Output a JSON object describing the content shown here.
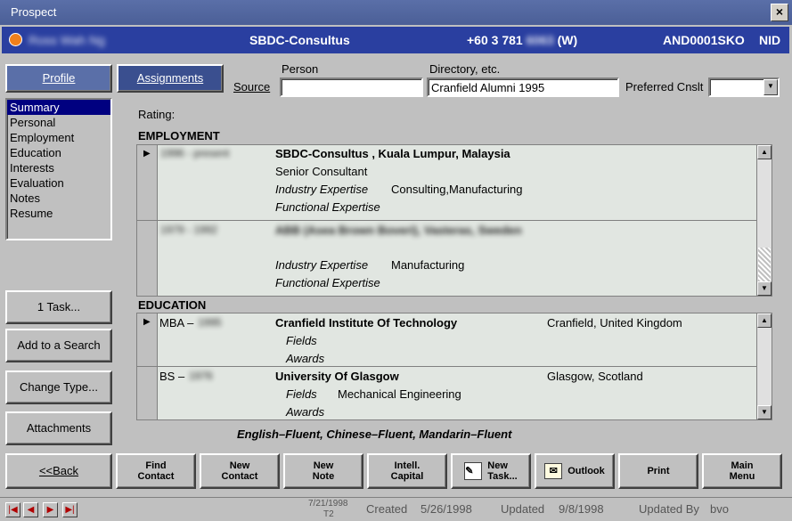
{
  "window": {
    "title": "Prospect",
    "close": "×"
  },
  "infobar": {
    "name": "Ross Wah Ng",
    "company": "SBDC-Consultus",
    "phone_prefix": "+60 3 781",
    "phone_hidden": "6063",
    "phone_suffix": "(W)",
    "code": "AND0001SKO",
    "flag": "NID"
  },
  "tabs": {
    "profile": "Profile",
    "assignments": "Assignments"
  },
  "source": {
    "label": "Source",
    "person_label": "Person",
    "person_value": "",
    "directory_label": "Directory, etc.",
    "directory_value": "Cranfield Alumni 1995",
    "preferred_label": "Preferred Cnslt",
    "preferred_value": ""
  },
  "sections": [
    "Summary",
    "Personal",
    "Employment",
    "Education",
    "Interests",
    "Evaluation",
    "Notes",
    "Resume"
  ],
  "side_buttons": {
    "task": "1 Task...",
    "add_search": "Add to a Search",
    "change_type": "Change Type...",
    "attachments": "Attachments",
    "back": "<<Back"
  },
  "rating_label": "Rating:",
  "employment": {
    "heading": "EMPLOYMENT",
    "entries": [
      {
        "dates": "1996 - present",
        "company": "SBDC-Consultus , Kuala Lumpur, Malaysia",
        "title": "Senior Consultant",
        "industry_label": "Industry Expertise",
        "industry": "Consulting,Manufacturing",
        "functional_label": "Functional Expertise",
        "functional": ""
      },
      {
        "dates": "1979 - 1992",
        "company": "ABB (Asea Brown Boveri), Vasteras, Sweden",
        "title": "",
        "industry_label": "Industry Expertise",
        "industry": "Manufacturing",
        "functional_label": "Functional Expertise",
        "functional": ""
      }
    ]
  },
  "education": {
    "heading": "EDUCATION",
    "entries": [
      {
        "degree": "MBA –",
        "year": "1995",
        "school": "Cranfield Institute Of Technology",
        "location": "Cranfield, United Kingdom",
        "fields_label": "Fields",
        "fields": "",
        "awards_label": "Awards"
      },
      {
        "degree": "BS –",
        "year": "1976",
        "school": "University Of Glasgow",
        "location": "Glasgow, Scotland",
        "fields_label": "Fields",
        "fields": "Mechanical Engineering",
        "awards_label": "Awards"
      }
    ]
  },
  "languages": "English–Fluent, Chinese–Fluent, Mandarin–Fluent",
  "toolbar": {
    "find1": "Find",
    "find2": "Contact",
    "newc1": "New",
    "newc2": "Contact",
    "newn1": "New",
    "newn2": "Note",
    "intel1": "Intell.",
    "intel2": "Capital",
    "task1": "New",
    "task2": "Task...",
    "outlook": "Outlook",
    "print": "Print",
    "main1": "Main",
    "main2": "Menu"
  },
  "status": {
    "date1": "7/21/1998",
    "date2": "T2",
    "created_label": "Created",
    "created": "5/26/1998",
    "updated_label": "Updated",
    "updated": "9/8/1998",
    "updated_by_label": "Updated By",
    "updated_by": "bvo"
  },
  "colors": {
    "titlebar": "#4b5f97",
    "infobar": "#2a3fa0",
    "panel": "#e1e6e1",
    "selected": "#000080"
  }
}
